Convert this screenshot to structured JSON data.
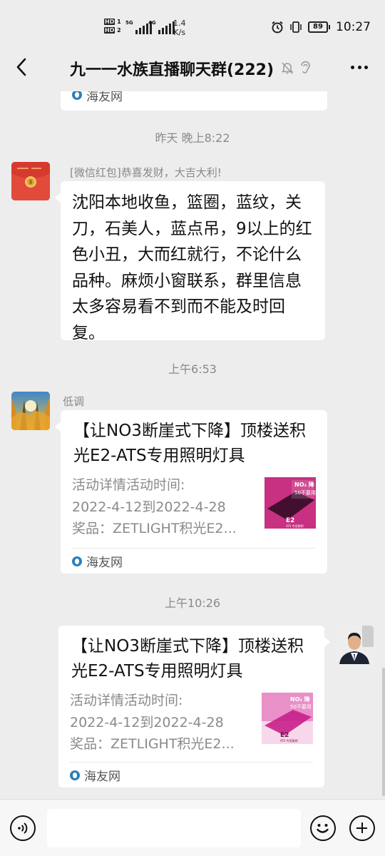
{
  "status_bar": {
    "sim1_label": "HD",
    "sim1_slot": "1",
    "sim2_label": "HD",
    "sim2_slot": "2",
    "signal1_label": "5G",
    "signal2_label": "4G",
    "net_speed_value": "1.4",
    "net_speed_unit": "K/s",
    "battery": "89",
    "time": "10:27",
    "icons": [
      "alarm-icon",
      "vibrate-icon",
      "battery-icon"
    ]
  },
  "title_bar": {
    "title": "九一一水族直播聊天群(222)",
    "icons": [
      "back-arrow-icon",
      "mute-bell-icon",
      "ear-icon",
      "more-dots-icon"
    ]
  },
  "messages": [
    {
      "type": "card-tail",
      "source": "海友网"
    },
    {
      "type": "timestamp",
      "text": "昨天 晚上8:22"
    },
    {
      "type": "text",
      "side": "left",
      "sender_name": "[微信红包]恭喜发财，大吉大利!",
      "avatar": "red-envelope-avatar",
      "text": "沈阳本地收鱼，篮圈，蓝纹，关刀，石美人，蓝点吊，9以上的红色小丑，大而红就行，不论什么品种。麻烦小窗联系，群里信息太多容易看不到而不能及时回复。"
    },
    {
      "type": "timestamp",
      "text": "上午6:53"
    },
    {
      "type": "card",
      "side": "left",
      "sender_name": "低调",
      "avatar": "autumn-forest-avatar",
      "title": "【让NO3断崖式下降】顶楼送积光E2-ATS专用照明灯具",
      "desc_lines": [
        "活动详情活动时间:",
        "2022-4-12到2022-4-28",
        "奖品：ZETLIGHT积光E2..."
      ],
      "source": "海友网"
    },
    {
      "type": "timestamp",
      "text": "上午10:26"
    },
    {
      "type": "card",
      "side": "right",
      "avatar": "man-in-suit-avatar",
      "title": "【让NO3断崖式下降】顶楼送积光E2-ATS专用照明灯具",
      "desc_lines": [
        "活动详情活动时间:",
        "2022-4-12到2022-4-28",
        "奖品：ZETLIGHT积光E2..."
      ],
      "source": "海友网"
    }
  ],
  "thumb_text": {
    "headline": "NO₃ 降",
    "sub": "50不要用",
    "model": "E2",
    "caption": "ATS 专用照明"
  },
  "input_bar": {
    "placeholder": "",
    "icons": [
      "voice-icon",
      "emoji-icon",
      "plus-icon"
    ]
  },
  "colors": {
    "background": "#ededed",
    "bubble": "#ffffff",
    "timestamp_text": "#8a8a8a",
    "red_envelope": "#e24a3b",
    "source_icon": "#2a7fb8"
  }
}
